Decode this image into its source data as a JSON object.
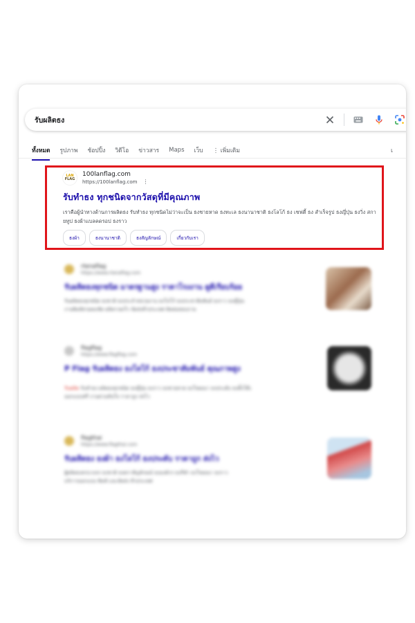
{
  "search": {
    "query": "รับผลิตธง"
  },
  "tabs": {
    "items": [
      "ทั้งหมด",
      "รูปภาพ",
      "ช้อปปิ้ง",
      "วิดีโอ",
      "ข่าวสาร",
      "Maps",
      "เว็บ",
      "⋮ เพิ่มเติม"
    ],
    "right_label": "เ"
  },
  "result1": {
    "logo_top": "LAN",
    "logo_bottom": "FLAG",
    "site_name": "100lanflag.com",
    "url": "https://100lanflag.com",
    "title": "รับทำธง ทุกชนิดจากวัสดุที่มีคุณภาพ",
    "snippet": "เราคือผู้นำทางด้านการผลิตธง รับทำธง ทุกชนิดไม่ว่าจะเป็น ธงชายหาด ธงทะเล ธงนานาชาติ ธงโลโก้ ธง เชฟตี้ ธง สำเร็จรูป ธงญี่ปุ่น ธงวิ่ง สกายทูป ธงผ้าแบลคดรอป ธงราว",
    "chips": [
      "ธงผ้า",
      "ธงนานาชาติ",
      "ธงสัญลักษณ์",
      "เกี่ยวกับเรา"
    ]
  },
  "blurred_results": [
    {
      "site_name": "rtenaflag",
      "url": "https://www.rtenaflag.com",
      "title": "รับผลิตธงทุกชนิด มาตรฐานสูง ราคาโรงงาน ดูดีเรียบร้อย",
      "text1": "รับผลิตธงทุกชนิด ธงชาติ ธงประจำหน่วยงาน ธงโลโก้ ธงประชาสัมพันธ์ ธงราว ธงญี่ปุ่น",
      "text2": "งานพิมพ์สวยคมชัด ผลิตรวดเร็ว จัดส่งทั่วประเทศ ติดต่อสอบถาม",
      "lead": ""
    },
    {
      "site_name": "flagflag",
      "url": "https://www.flagflag.com",
      "title": "P Flag รับผลิตธง ธงโลโก้ ธงประชาสัมพันธ์ คุณภาพสูง",
      "text1": "รับทำธง ผลิตธงทุกชนิด ธงญี่ปุ่น ธงราว ธงชายหาด ธงโฆษณา ธงประดับ ธงตั้งโต๊ะ",
      "text2": "ออกแบบฟรี งานด่วนทันใจ ราคาถูก ส่งไว",
      "lead": "รับผลิต"
    },
    {
      "site_name": "flagthai",
      "url": "https://www.flagthai.com",
      "title": "รับผลิตธง ธงผ้า ธงโลโก้ ธงประดับ ราคาถูก ส่งไว",
      "text1": "ผู้ผลิตธงครบวงจร ธงชาติ ธงตราสัญลักษณ์ ธงองค์กร ธงกีฬา ธงโฆษณา ธงราว",
      "text2": "บริการออกแบบ พิมพ์ และจัดส่ง ทั่วประเทศ",
      "lead": ""
    }
  ],
  "colors": {
    "highlight_border": "#e0141a",
    "link": "#1a0dab",
    "mic_blue": "#4285f4"
  },
  "icons": [
    "close-icon",
    "keyboard-icon",
    "mic-icon",
    "lens-icon",
    "kebab-menu-icon"
  ]
}
